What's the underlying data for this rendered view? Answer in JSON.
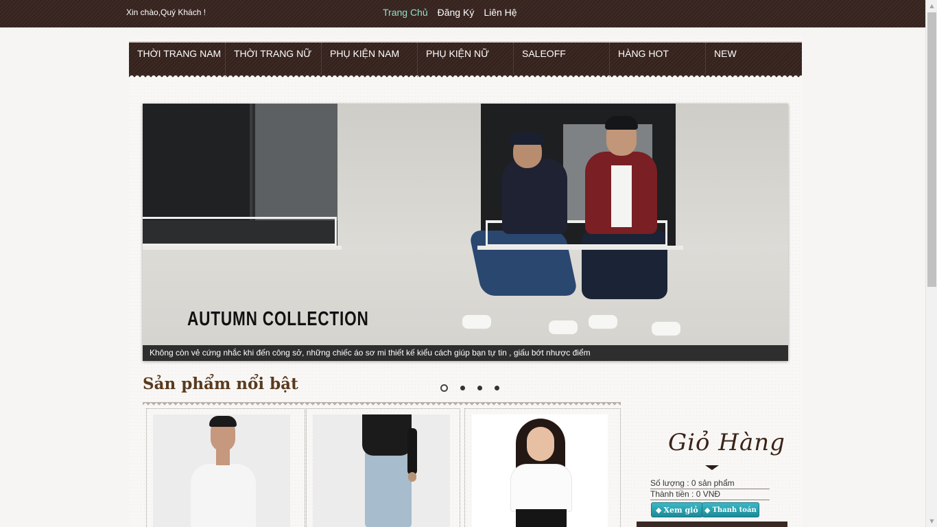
{
  "topbar": {
    "greeting": "Xin chào,Quý Khách !",
    "links": [
      {
        "label": "Trang Chủ"
      },
      {
        "label": "Đăng Ký"
      },
      {
        "label": "Liên Hệ"
      }
    ],
    "active_link_color": "#8ee3c8"
  },
  "nav": {
    "items": [
      {
        "label": "THỜI TRANG NAM"
      },
      {
        "label": "THỜI TRANG NỮ"
      },
      {
        "label": "PHỤ KIỆN NAM"
      },
      {
        "label": "PHỤ KIỆN NỮ"
      },
      {
        "label": "SALEOFF"
      },
      {
        "label": "HÀNG HOT"
      },
      {
        "label": "NEW"
      }
    ]
  },
  "banner": {
    "title": "AUTUMN COLLECTION",
    "caption": "Không còn vẻ cứng nhắc khi đến công sở, những chiếc áo sơ mi thiết kế kiểu cách giúp bạn tự tin , giấu bớt nhược điểm",
    "slide_count": 4,
    "active_slide": 1
  },
  "featured": {
    "title": "Sản phẩm nổi bật"
  },
  "cart": {
    "title": "Giỏ Hàng",
    "quantity_text": "Số lượng : 0 sản phẩm",
    "total_text": "Thành tiền : 0 VNĐ",
    "view_button": "Xem giỏ",
    "checkout_button": "Thanh toán",
    "button_icon": "◆"
  },
  "colors": {
    "brand_brown": "#3e2a25",
    "button_teal": "#2aa3b1"
  }
}
